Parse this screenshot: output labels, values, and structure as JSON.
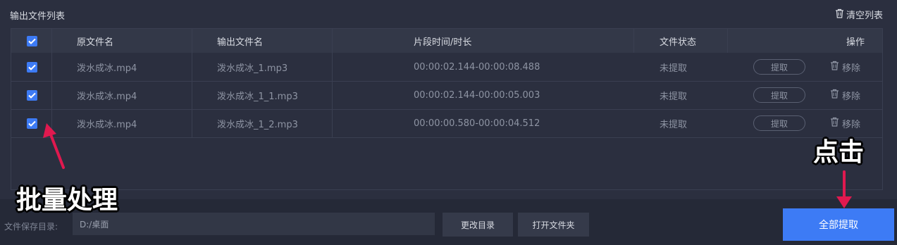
{
  "header": {
    "title": "输出文件列表",
    "clear_label": "清空列表"
  },
  "table": {
    "columns": [
      "原文件名",
      "输出文件名",
      "片段时间/时长",
      "文件状态",
      "操作"
    ],
    "rows": [
      {
        "source": "泼水成冰.mp4",
        "output": "泼水成冰_1.mp3",
        "time": "00:00:02.144-00:00:08.488",
        "status": "未提取",
        "extract": "提取",
        "remove": "移除"
      },
      {
        "source": "泼水成冰.mp4",
        "output": "泼水成冰_1_1.mp3",
        "time": "00:00:02.144-00:00:05.003",
        "status": "未提取",
        "extract": "提取",
        "remove": "移除"
      },
      {
        "source": "泼水成冰.mp4",
        "output": "泼水成冰_1_2.mp3",
        "time": "00:00:00.580-00:00:04.512",
        "status": "未提取",
        "extract": "提取",
        "remove": "移除"
      }
    ]
  },
  "footer": {
    "dir_label": "文件保存目录:",
    "dir_value": "D:/桌面",
    "change_dir": "更改目录",
    "open_folder": "打开文件夹",
    "extract_all": "全部提取"
  },
  "annotations": {
    "batch": "批量处理",
    "click": "点击",
    "arrow_color": "#e0194f"
  },
  "colors": {
    "accent": "#3d7bf5",
    "background": "#2b2f3f"
  }
}
